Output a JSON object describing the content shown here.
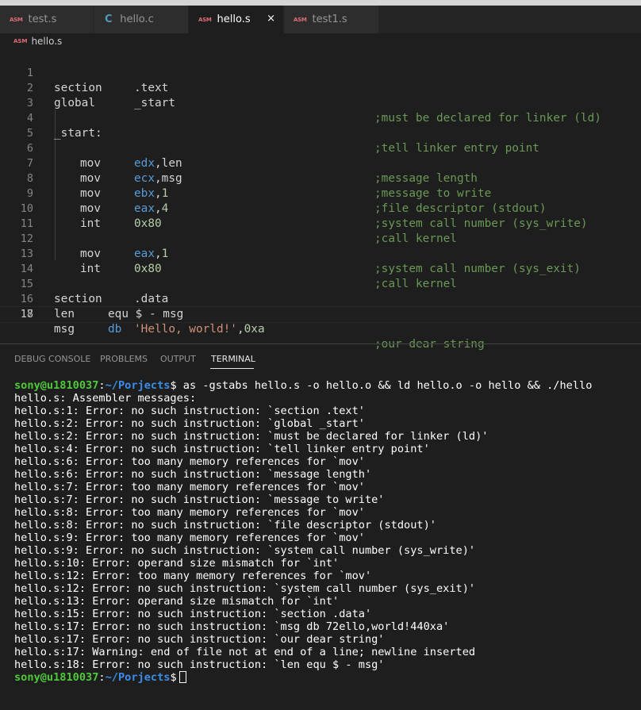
{
  "tabs": [
    {
      "icon": "ASM",
      "label": "test.s"
    },
    {
      "icon": "C",
      "label": "hello.c"
    },
    {
      "icon": "ASM",
      "label": "hello.s",
      "close": "×"
    },
    {
      "icon": "ASM",
      "label": "test1.s"
    }
  ],
  "breadcrumb": {
    "icon": "ASM",
    "file": "hello.s"
  },
  "editor": {
    "lines": [
      {
        "n": "1"
      },
      {
        "n": "2"
      },
      {
        "n": "3"
      },
      {
        "n": "4"
      },
      {
        "n": "5"
      },
      {
        "n": "6"
      },
      {
        "n": "7"
      },
      {
        "n": "8"
      },
      {
        "n": "9"
      },
      {
        "n": "10"
      },
      {
        "n": "11"
      },
      {
        "n": "12"
      },
      {
        "n": "13"
      },
      {
        "n": "14"
      },
      {
        "n": "15"
      },
      {
        "n": "16"
      },
      {
        "n": "17"
      },
      {
        "n": "18"
      }
    ],
    "code": {
      "l1": {
        "kw": "section",
        "arg": ".text"
      },
      "l2": {
        "kw": "global",
        "arg": "_start",
        "comment": ";must be declared for linker (ld)"
      },
      "l4": {
        "label": "_start:",
        "comment": ";tell linker entry point"
      },
      "l6": {
        "kw": "mov",
        "reg": "edx",
        "rest": ",len",
        "comment": ";message length"
      },
      "l7": {
        "kw": "mov",
        "reg": "ecx",
        "rest": ",msg",
        "comment": ";message to write"
      },
      "l8": {
        "kw": "mov",
        "reg": "ebx",
        "rest": ",",
        "num": "1",
        "comment": ";file descriptor (stdout)"
      },
      "l9": {
        "kw": "mov",
        "reg": "eax",
        "rest": ",",
        "num": "4",
        "comment": ";system call number (sys_write)"
      },
      "l10": {
        "kw": "int",
        "num": "0x80",
        "comment": ";call kernel"
      },
      "l12": {
        "kw": "mov",
        "reg": "eax",
        "rest": ",",
        "num": "1",
        "comment": ";system call number (sys_exit)"
      },
      "l13": {
        "kw": "int",
        "num": "0x80",
        "comment": ";call kernel"
      },
      "l15": {
        "kw": "section",
        "arg": ".data"
      },
      "l17": {
        "name": "msg",
        "dir": "db",
        "str": "'Hello, world!'",
        "rest": ",",
        "num": "0xa",
        "comment": ";our dear string"
      },
      "l18": {
        "name": "len",
        "rest": "equ $ - msg"
      }
    }
  },
  "panel": {
    "tabs": [
      "DEBUG CONSOLE",
      "PROBLEMS",
      "OUTPUT",
      "TERMINAL"
    ],
    "active": "TERMINAL"
  },
  "terminal": {
    "prompt_user": "sony@u1810037",
    "prompt_colon": ":",
    "prompt_path": "~/Porjects",
    "prompt_dollar": "$",
    "command": " as -gstabs hello.s -o hello.o && ld hello.o -o hello && ./hello",
    "output": [
      "hello.s: Assembler messages:",
      "hello.s:1: Error: no such instruction: `section .text'",
      "hello.s:2: Error: no such instruction: `global _start'",
      "hello.s:2: Error: no such instruction: `must be declared for linker (ld)'",
      "hello.s:4: Error: no such instruction: `tell linker entry point'",
      "hello.s:6: Error: too many memory references for `mov'",
      "hello.s:6: Error: no such instruction: `message length'",
      "hello.s:7: Error: too many memory references for `mov'",
      "hello.s:7: Error: no such instruction: `message to write'",
      "hello.s:8: Error: too many memory references for `mov'",
      "hello.s:8: Error: no such instruction: `file descriptor (stdout)'",
      "hello.s:9: Error: too many memory references for `mov'",
      "hello.s:9: Error: no such instruction: `system call number (sys_write)'",
      "hello.s:10: Error: operand size mismatch for `int'",
      "hello.s:12: Error: too many memory references for `mov'",
      "hello.s:12: Error: no such instruction: `system call number (sys_exit)'",
      "hello.s:13: Error: operand size mismatch for `int'",
      "hello.s:15: Error: no such instruction: `section .data'",
      "hello.s:17: Error: no such instruction: `msg db 72ello,world!440xa'",
      "hello.s:17: Error: no such instruction: `our dear string'",
      "hello.s:17: Warning: end of file not at end of a line; newline inserted",
      "hello.s:18: Error: no such instruction: `len equ $ - msg'"
    ]
  }
}
